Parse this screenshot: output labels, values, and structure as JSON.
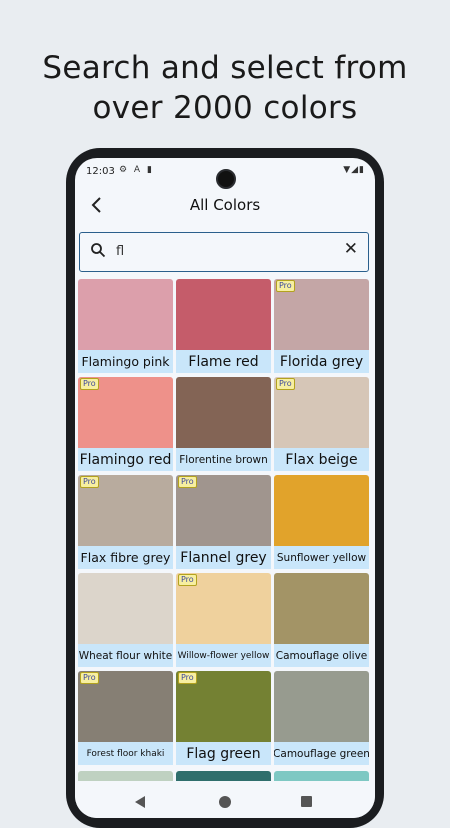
{
  "headline": {
    "line1": "Search and select from",
    "line2": "over 2000 colors"
  },
  "status": {
    "time": "12:03",
    "left_icons": "⚙ A ▮",
    "right_icons": "▼◢▮"
  },
  "appbar": {
    "title": "All Colors",
    "back_icon": "arrow-back-icon"
  },
  "search": {
    "value": "fl",
    "placeholder": "",
    "clear_icon": "close-icon"
  },
  "pro_badge": "Pro",
  "colors": [
    {
      "name": "Flamingo pink",
      "hex": "#dc9fab",
      "pro": false
    },
    {
      "name": "Flame red",
      "hex": "#c55c6a",
      "pro": false
    },
    {
      "name": "Florida grey",
      "hex": "#c4a6a6",
      "pro": true
    },
    {
      "name": "Flamingo red",
      "hex": "#ee918a",
      "pro": true
    },
    {
      "name": "Florentine brown",
      "hex": "#836455",
      "pro": false
    },
    {
      "name": "Flax beige",
      "hex": "#d6c6b7",
      "pro": true
    },
    {
      "name": "Flax fibre grey",
      "hex": "#b8ab9e",
      "pro": true
    },
    {
      "name": "Flannel grey",
      "hex": "#a0958e",
      "pro": true
    },
    {
      "name": "Sunflower yellow",
      "hex": "#e1a32b",
      "pro": false
    },
    {
      "name": "Wheat flour white",
      "hex": "#dcd5cb",
      "pro": false
    },
    {
      "name": "Willow-flower yellow",
      "hex": "#efd19d",
      "pro": true
    },
    {
      "name": "Camouflage olive",
      "hex": "#a39466",
      "pro": false
    },
    {
      "name": "Forest floor khaki",
      "hex": "#867f74",
      "pro": true
    },
    {
      "name": "Flag green",
      "hex": "#748133",
      "pro": true
    },
    {
      "name": "Camouflage green",
      "hex": "#979b8f",
      "pro": false
    }
  ],
  "partial_colors": [
    "#bfd1c1",
    "#2f6e6c",
    "#7ec8c3"
  ],
  "navbar": {
    "back": "nav-back-icon",
    "home": "nav-home-icon",
    "recents": "nav-recents-icon"
  }
}
